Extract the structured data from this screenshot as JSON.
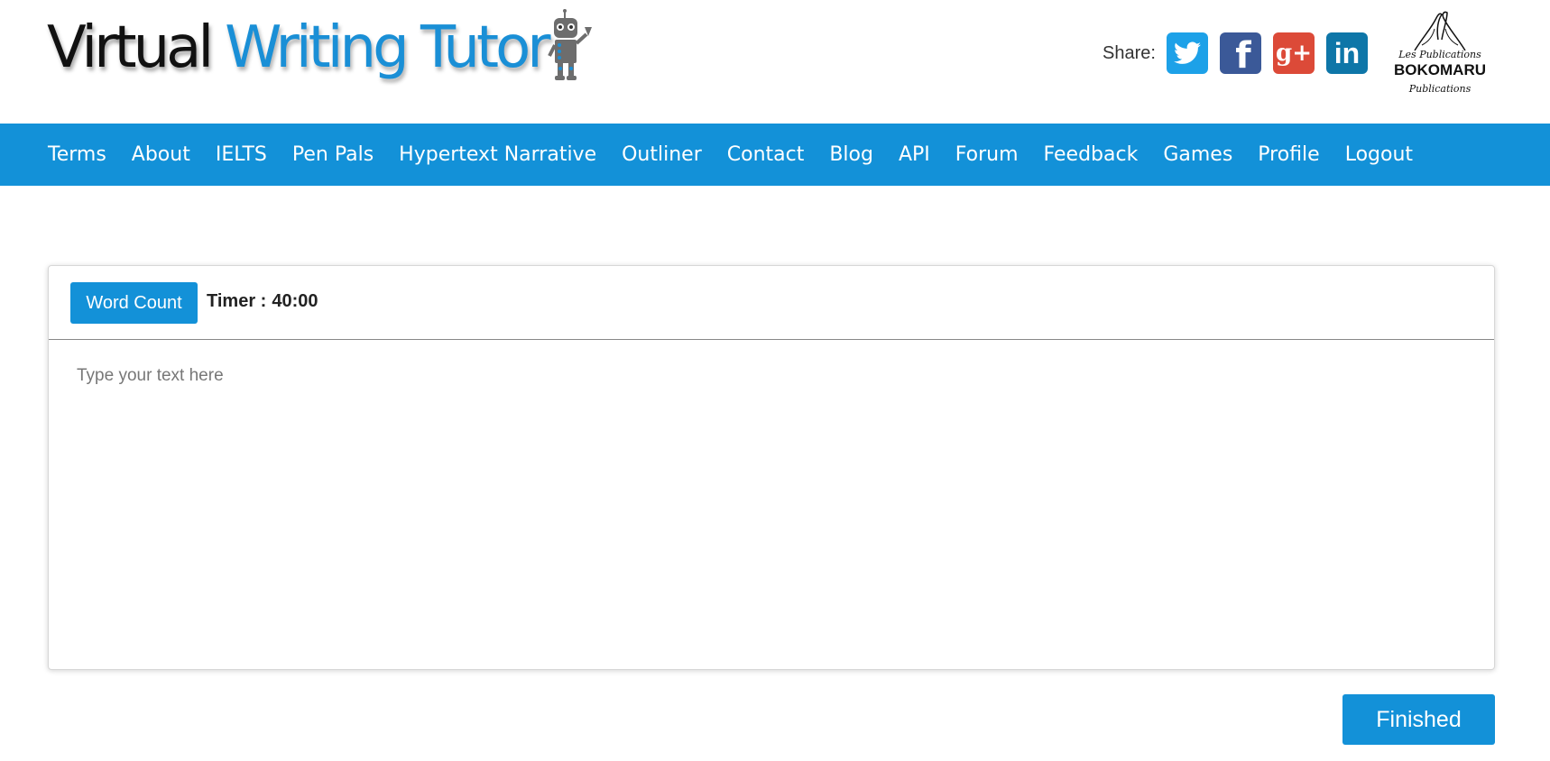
{
  "header": {
    "logo": {
      "part1": "Virtual",
      "part2": "Writing Tutor",
      "icon": "robot-icon"
    },
    "share": {
      "label": "Share:",
      "icons": [
        "twitter-icon",
        "facebook-icon",
        "google-plus-icon",
        "linkedin-icon"
      ],
      "facebook_glyph": "f",
      "google_glyph": "g+",
      "linkedin_glyph": "in"
    },
    "publisher": {
      "top": "Les Publications",
      "main": "BOKOMARU",
      "bottom": "Publications"
    }
  },
  "nav": {
    "items": [
      "Terms",
      "About",
      "IELTS",
      "Pen Pals",
      "Hypertext Narrative",
      "Outliner",
      "Contact",
      "Blog",
      "API",
      "Forum",
      "Feedback",
      "Games",
      "Profile",
      "Logout"
    ]
  },
  "editor": {
    "word_count_label": "Word Count",
    "timer_label": "Timer :",
    "timer_value": "40:00",
    "placeholder": "Type your text here",
    "value": ""
  },
  "footer": {
    "finished_label": "Finished"
  },
  "colors": {
    "accent": "#1391d8",
    "twitter": "#1da1e8",
    "facebook": "#3b5998",
    "google_plus": "#dc4a38",
    "linkedin": "#0e76a8"
  }
}
